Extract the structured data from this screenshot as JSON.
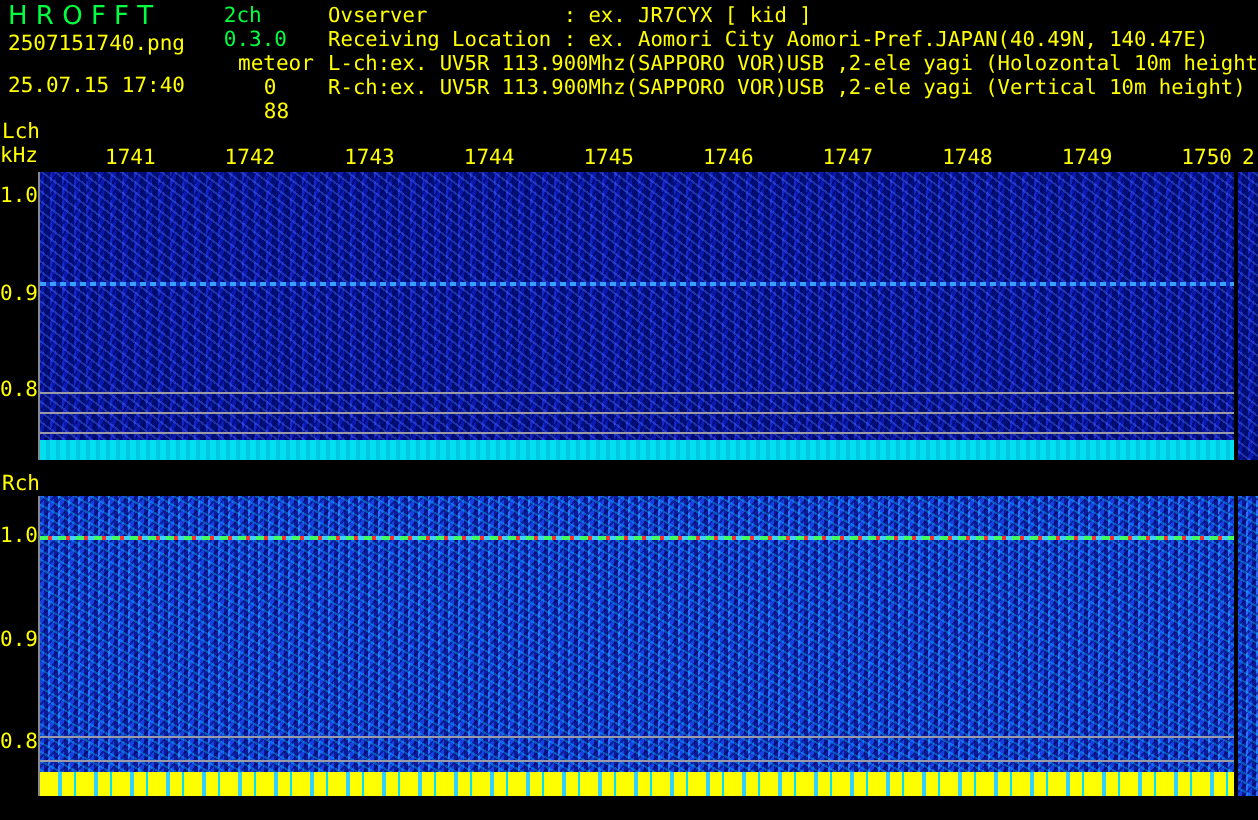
{
  "app": {
    "title": "H R O F F T",
    "version": "2ch 0.3.0"
  },
  "file": {
    "name": "2507151740.png",
    "datetime": "25.07.15 17:40"
  },
  "meteor": {
    "label": "meteor",
    "counts": [
      "0",
      "88"
    ]
  },
  "info": [
    "Ovserver           : ex. JR7CYX [ kid ]",
    "Receiving Location : ex. Aomori City Aomori-Pref.JAPAN(40.49N, 140.47E)",
    "L-ch:ex. UV5R 113.900Mhz(SAPPORO VOR)USB ,2-ele yagi (Holozontal 10m height",
    "R-ch:ex. UV5R 113.900Mhz(SAPPORO VOR)USB ,2-ele yagi (Vertical 10m height)"
  ],
  "time_axis": {
    "labels": [
      "1741",
      "1742",
      "1743",
      "1744",
      "1745",
      "1746",
      "1747",
      "1748",
      "1749",
      "1750"
    ],
    "next": "2"
  },
  "channels": [
    {
      "label": "Lch",
      "unit": "kHz",
      "ticks": [
        "1.0",
        "0.9",
        "0.8"
      ],
      "kind": "quiet"
    },
    {
      "label": "Rch",
      "ticks": [
        "1.0",
        "0.9",
        "0.8"
      ],
      "kind": "busy"
    }
  ]
}
